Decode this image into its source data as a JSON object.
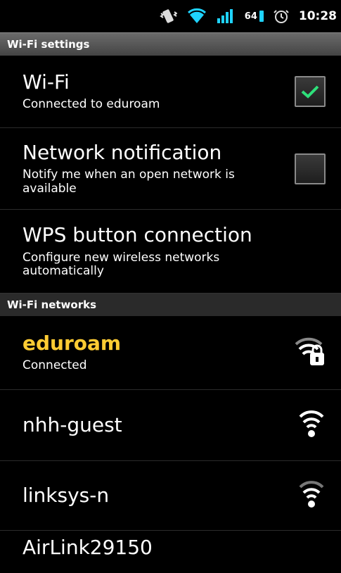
{
  "status_bar": {
    "icons": [
      "vibrate-icon",
      "wifi-signal-icon",
      "cell-signal-icon",
      "battery-icon",
      "alarm-icon"
    ],
    "battery_level": "64",
    "time": "10:28",
    "accent_color": "#1fd3ff"
  },
  "wifi_settings": {
    "header": "Wi-Fi settings",
    "wifi": {
      "title": "Wi-Fi",
      "summary": "Connected to eduroam",
      "checked": true
    },
    "notification": {
      "title": "Network notification",
      "summary": "Notify me when an open network is available",
      "checked": false
    },
    "wps": {
      "title": "WPS button connection",
      "summary": "Configure new wireless networks automatically"
    }
  },
  "networks": {
    "header": "Wi-Fi networks",
    "items": [
      {
        "name": "eduroam",
        "status": "Connected",
        "icon": "wifi-lock-icon",
        "connected": true
      },
      {
        "name": "nhh-guest",
        "icon": "wifi-signal-icon"
      },
      {
        "name": "linksys-n",
        "icon": "wifi-signal-icon"
      },
      {
        "name": "AirLink29150",
        "icon": "wifi-signal-icon"
      }
    ]
  },
  "colors": {
    "connected_network": "#ffcc33",
    "check_mark": "#2ee07a"
  }
}
